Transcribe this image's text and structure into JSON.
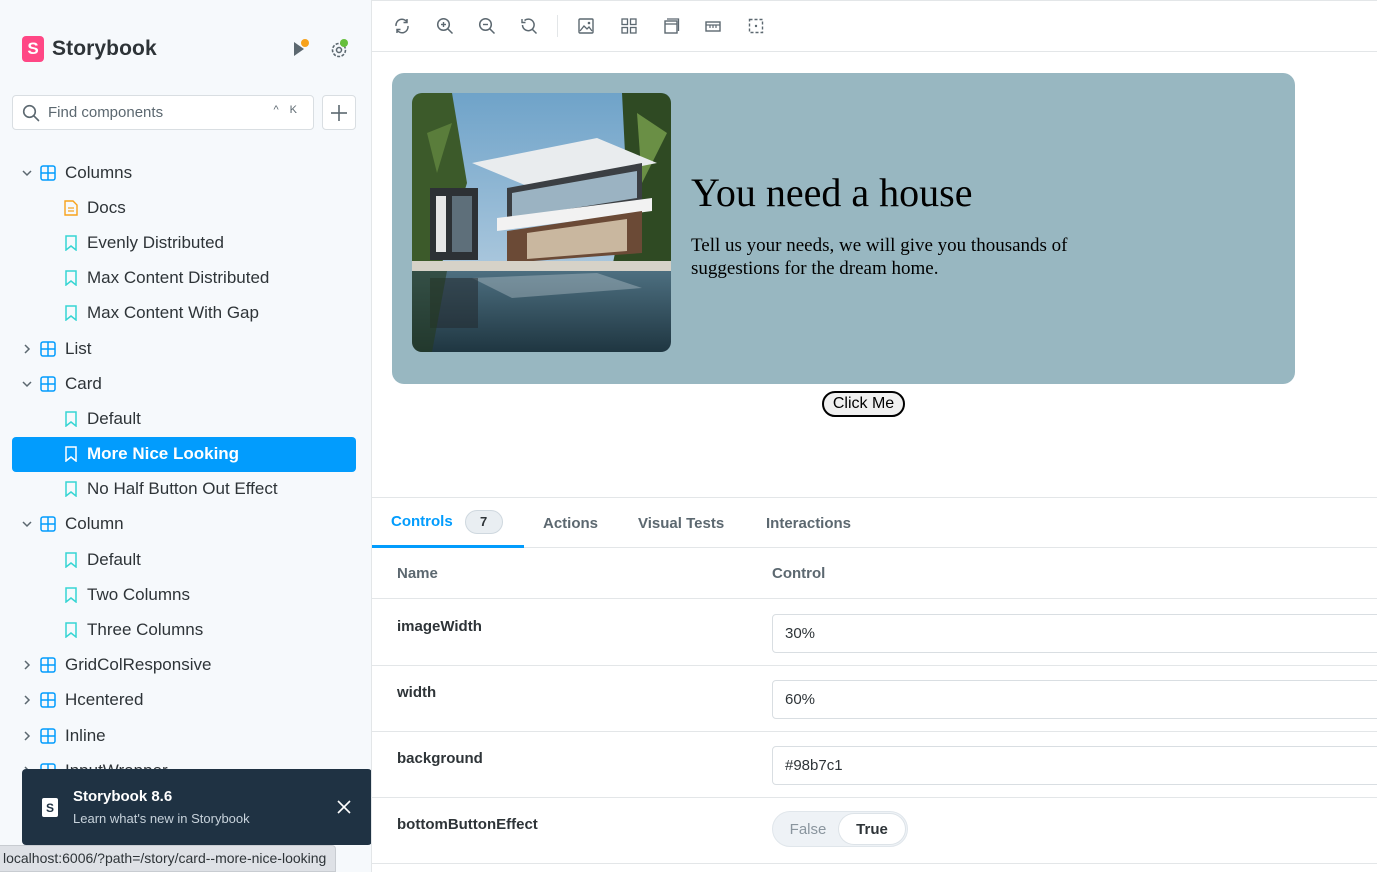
{
  "brand": {
    "name": "Storybook",
    "logo_letter": "S"
  },
  "search": {
    "placeholder": "Find components",
    "shortcut": "^ K"
  },
  "tree": [
    {
      "type": "group",
      "label": "Columns",
      "expanded": true
    },
    {
      "type": "docs",
      "label": "Docs"
    },
    {
      "type": "story",
      "label": "Evenly Distributed"
    },
    {
      "type": "story",
      "label": "Max Content Distributed"
    },
    {
      "type": "story",
      "label": "Max Content With Gap"
    },
    {
      "type": "group",
      "label": "List",
      "expanded": false
    },
    {
      "type": "group",
      "label": "Card",
      "expanded": true
    },
    {
      "type": "story",
      "label": "Default"
    },
    {
      "type": "story",
      "label": "More Nice Looking",
      "selected": true
    },
    {
      "type": "story",
      "label": "No Half Button Out Effect"
    },
    {
      "type": "group",
      "label": "Column",
      "expanded": true
    },
    {
      "type": "story",
      "label": "Default"
    },
    {
      "type": "story",
      "label": "Two Columns"
    },
    {
      "type": "story",
      "label": "Three Columns"
    },
    {
      "type": "group",
      "label": "GridColResponsive",
      "expanded": false
    },
    {
      "type": "group",
      "label": "Hcentered",
      "expanded": false
    },
    {
      "type": "group",
      "label": "Inline",
      "expanded": false
    },
    {
      "type": "group",
      "label": "InputWrapper",
      "expanded": false
    }
  ],
  "toast": {
    "title": "Storybook 8.6",
    "subtitle": "Learn what's new in Storybook"
  },
  "statusbar": {
    "url": "localhost:6006/?path=/story/card--more-nice-looking"
  },
  "toolbar": {
    "buttons": [
      "reload-icon",
      "zoom-in-icon",
      "zoom-out-icon",
      "zoom-reset-icon",
      "background-icon",
      "grid-icon",
      "viewport-icon",
      "measure-icon",
      "outline-icon"
    ]
  },
  "preview": {
    "title": "You need a house",
    "text": "Tell us your needs, we will give you thousands of suggestions for the dream home.",
    "button_label": "Click Me",
    "background": "#98b7c1",
    "image_alt": "modern house with pool"
  },
  "panel": {
    "tabs": [
      {
        "label": "Controls",
        "badge": "7",
        "active": true
      },
      {
        "label": "Actions"
      },
      {
        "label": "Visual Tests"
      },
      {
        "label": "Interactions"
      }
    ],
    "columns": {
      "name": "Name",
      "control": "Control"
    },
    "controls": [
      {
        "name": "imageWidth",
        "value": "30%"
      },
      {
        "name": "width",
        "value": "60%"
      },
      {
        "name": "background",
        "value": "#98b7c1"
      },
      {
        "name": "bottomButtonEffect",
        "options": [
          "False",
          "True"
        ],
        "selected": "True"
      }
    ]
  },
  "colors": {
    "accent": "#029cfd",
    "brand": "#ff4785",
    "card_bg": "#98b7c1",
    "toast_bg": "#1f3243"
  }
}
